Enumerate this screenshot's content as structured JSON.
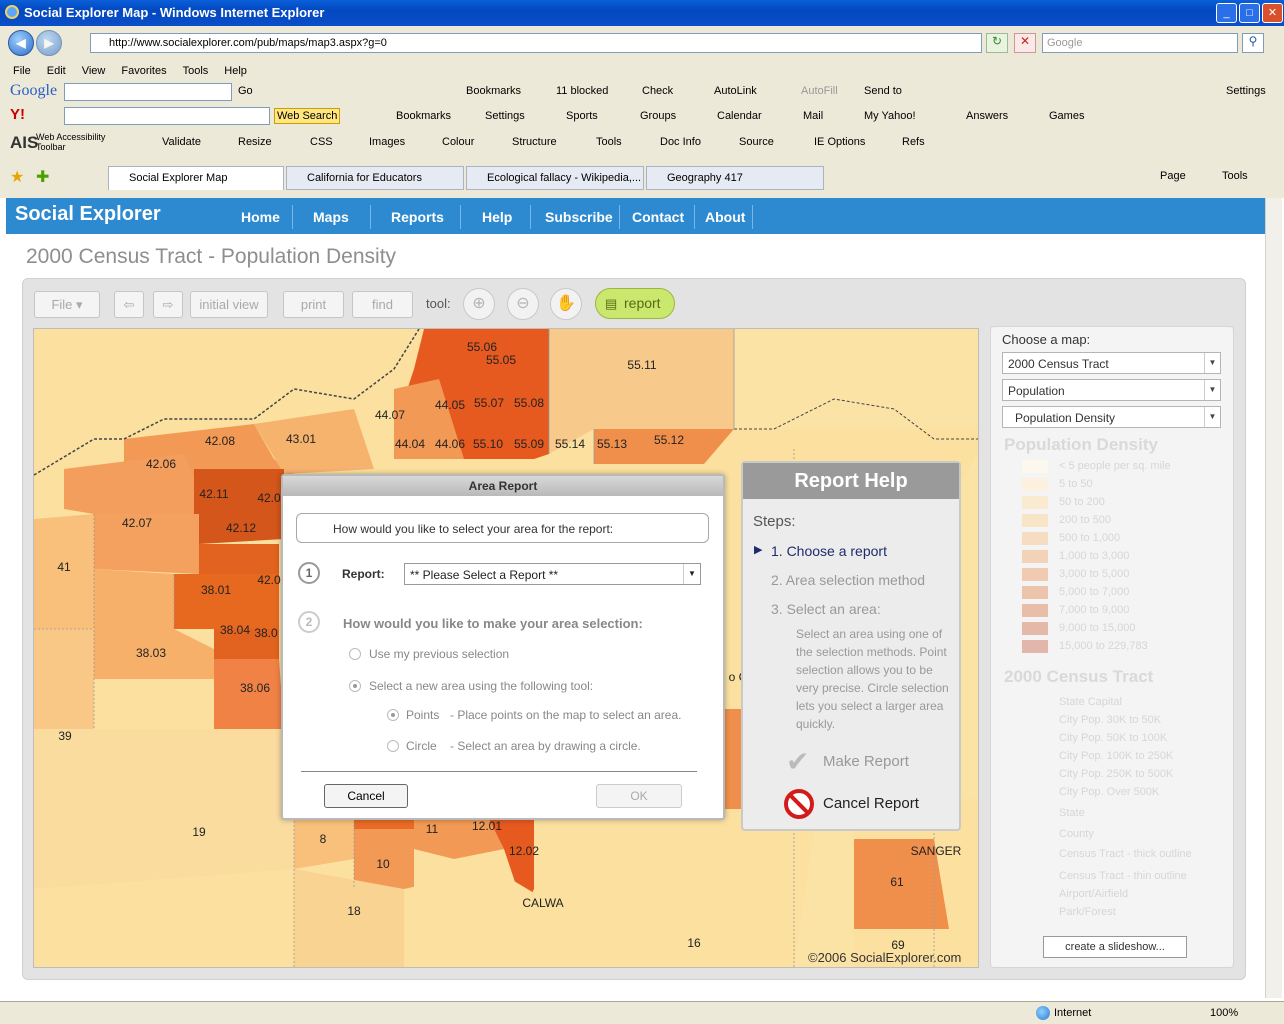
{
  "window": {
    "title": "Social Explorer Map - Windows Internet Explorer"
  },
  "address": {
    "url": "http://www.socialexplorer.com/pub/maps/map3.aspx?g=0",
    "search_placeholder": "Google"
  },
  "menu": [
    "File",
    "Edit",
    "View",
    "Favorites",
    "Tools",
    "Help"
  ],
  "google_toolbar": {
    "logo": "Google",
    "go": "Go",
    "items": [
      "Bookmarks",
      "11 blocked",
      "Check",
      "AutoLink",
      "AutoFill",
      "Send to",
      "Settings"
    ]
  },
  "yahoo_toolbar": {
    "search_btn": "Web Search",
    "items": [
      "Bookmarks",
      "Settings",
      "Sports",
      "Groups",
      "Calendar",
      "Mail",
      "My Yahoo!",
      "Answers",
      "Games"
    ]
  },
  "ais_toolbar": {
    "logo_line1": "Web Accessibility",
    "logo_line2": "Toolbar",
    "items": [
      "Validate",
      "Resize",
      "CSS",
      "Images",
      "Colour",
      "Structure",
      "Tools",
      "Doc Info",
      "Source",
      "IE Options",
      "Refs"
    ]
  },
  "tabs": [
    "Social Explorer Map",
    "California for Educators",
    "Ecological fallacy - Wikipedia,...",
    "Geography 417"
  ],
  "ie_cmd": {
    "page": "Page",
    "tools": "Tools"
  },
  "site": {
    "logo": "Social Explorer",
    "nav": [
      "Home",
      "Maps",
      "Reports",
      "Help",
      "Subscribe",
      "Contact",
      "About"
    ],
    "page_title": "2000 Census Tract - Population Density"
  },
  "map_toolbar": {
    "file": "File",
    "initial_view": "initial view",
    "print": "print",
    "find": "find",
    "tool_label": "tool:",
    "report": "report"
  },
  "map": {
    "copyright": "©2006 SocialExplorer.com",
    "labels": [
      "55.06",
      "55.05",
      "55.11",
      "44.07",
      "44.05",
      "55.07",
      "55.08",
      "42.08",
      "43.01",
      "44.04",
      "44.06",
      "55.10",
      "55.09",
      "55.14",
      "55.13",
      "55.12",
      "42.06",
      "42.11",
      "42.0",
      "42.07",
      "42.12",
      "41",
      "42.0",
      "38.01",
      "38.04",
      "38.0",
      "38.03",
      "38.06",
      "39",
      "19",
      "8",
      "11",
      "12.01",
      "10",
      "12.02",
      "18",
      "CALWA",
      "SANGER",
      "61",
      "16",
      "69",
      "o C"
    ]
  },
  "side": {
    "choose_label": "Choose a map:",
    "selects": [
      "2000 Census Tract",
      "Population",
      "Population Density"
    ],
    "density_title": "Population Density",
    "density_rows": [
      "< 5 people per sq. mile",
      "5 to 50",
      "50 to 200",
      "200 to 500",
      "500 to 1,000",
      "1,000 to 3,000",
      "3,000 to 5,000",
      "5,000 to 7,000",
      "7,000 to 9,000",
      "9,000 to 15,000",
      "15,000 to 229,783"
    ],
    "density_colors": [
      "#fdf8ee",
      "#fbf1de",
      "#f9ead0",
      "#f8e4c6",
      "#f6dcc0",
      "#f3d3b8",
      "#f0cbb1",
      "#ecc3ab",
      "#e8bea9",
      "#e4b9aa",
      "#e2b6ab"
    ],
    "tract_title": "2000 Census Tract",
    "tract_rows": [
      "State Capital",
      "City Pop. 30K to 50K",
      "City Pop. 50K to 100K",
      "City Pop. 100K to 250K",
      "City Pop. 250K to 500K",
      "City Pop. Over 500K",
      "State",
      "County",
      "Census Tract - thick outline",
      "Census Tract - thin outline",
      "Airport/Airfield",
      "Park/Forest"
    ],
    "slideshow": "create a slideshow..."
  },
  "dialog": {
    "title": "Area Report",
    "question1": "How would you like to select your area for the report:",
    "step1": "1",
    "report_label": "Report:",
    "report_value": "** Please Select a Report **",
    "step2": "2",
    "question2": "How would you like to make your area selection:",
    "opt_previous": "Use my previous selection",
    "opt_new": "Select a new area using the following tool:",
    "points_label": "Points",
    "points_desc": "-  Place points on the map to select an area.",
    "circle_label": "Circle",
    "circle_desc": "-  Select an area by drawing a circle.",
    "cancel": "Cancel",
    "ok": "OK"
  },
  "help": {
    "title": "Report Help",
    "steps_label": "Steps:",
    "step1": "1.  Choose a report",
    "step2": "2.  Area selection method",
    "step3": "3.  Select an area:",
    "step3_desc": "Select an area using one of the selection methods. Point selection allows you to be very precise. Circle selection lets you select a larger area quickly.",
    "make": "Make Report",
    "cancel": "Cancel Report"
  },
  "status": {
    "zone": "Internet",
    "zoom": "100%"
  }
}
